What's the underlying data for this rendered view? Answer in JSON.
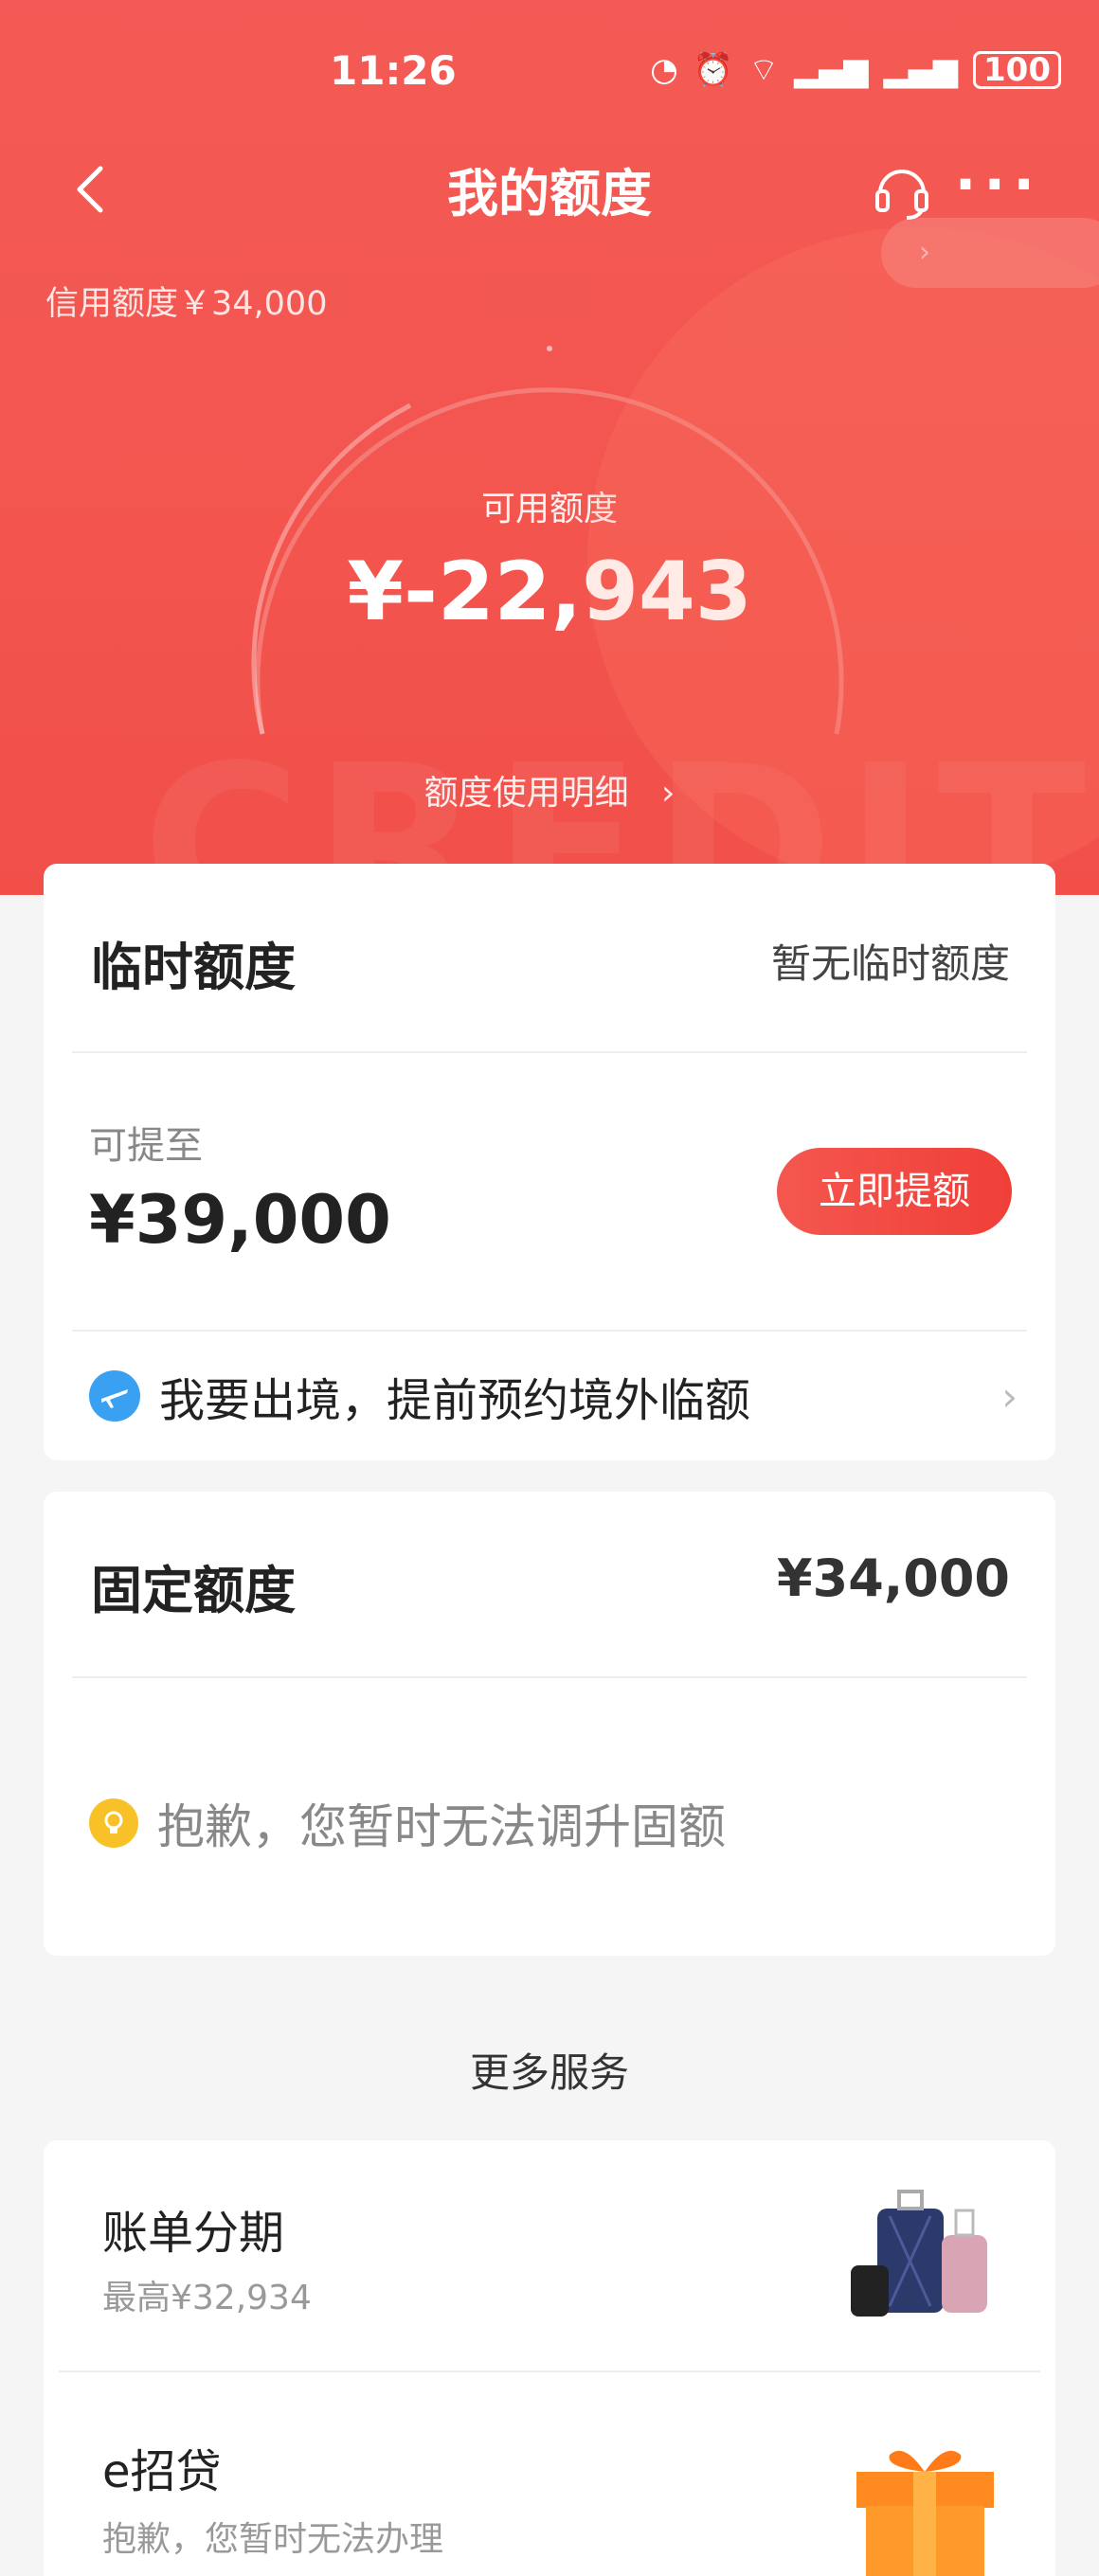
{
  "status_bar": {
    "time": "11:26",
    "battery": "100"
  },
  "nav": {
    "title": "我的额度"
  },
  "hero": {
    "credit_limit": "信用额度￥34,000",
    "available_label": "可用额度",
    "available_amount": "¥-22,943",
    "detail_link": "额度使用明细",
    "bg_text": "CREDIT"
  },
  "temp_limit": {
    "title": "临时额度",
    "status": "暂无临时额度",
    "raise_label": "可提至",
    "raise_amount": "¥39,000",
    "raise_button": "立即提额",
    "travel_link": "我要出境，提前预约境外临额"
  },
  "fixed_limit": {
    "title": "固定额度",
    "amount": "¥34,000",
    "notice": "抱歉，您暂时无法调升固额"
  },
  "more_services": {
    "title": "更多服务",
    "items": [
      {
        "title": "账单分期",
        "subtitle": "最高¥32,934"
      },
      {
        "title": "e招贷",
        "subtitle": "抱歉，您暂时无法办理"
      }
    ]
  },
  "colors": {
    "brand_red": "#f3554f",
    "button_red": "#ef3f38"
  }
}
